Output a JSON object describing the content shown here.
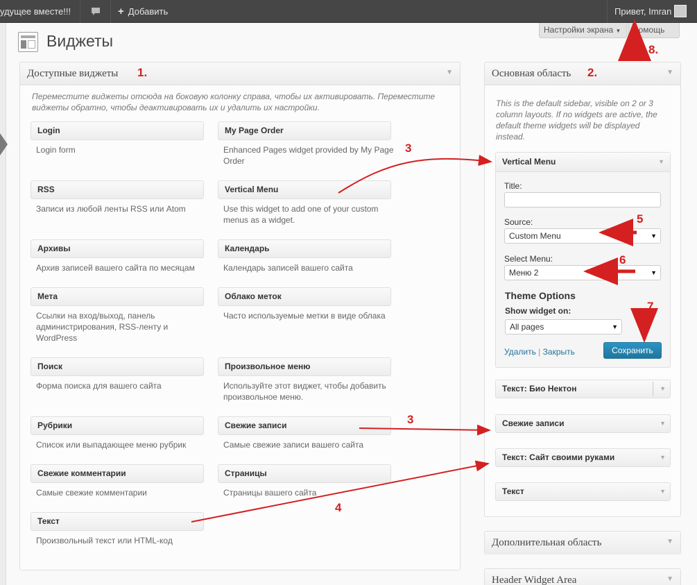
{
  "adminbar": {
    "site": "удущее вместе!!!",
    "comments_icon": "comment-bubble-icon",
    "add_label": "Добавить",
    "account": "Привет, Imran"
  },
  "screen_meta": {
    "screen_options": "Настройки экрана",
    "help": "Помощь"
  },
  "page": {
    "title": "Виджеты"
  },
  "available": {
    "title": "Доступные виджеты",
    "description": "Переместите виджеты отсюда на боковую колонку справа, чтобы их активировать. Переместите виджеты обратно, чтобы деактивировать их и удалить их настройки.",
    "widgets": [
      {
        "title": "Login",
        "desc": "Login form"
      },
      {
        "title": "My Page Order",
        "desc": "Enhanced Pages widget provided by My Page Order"
      },
      {
        "title": "RSS",
        "desc": "Записи из любой ленты RSS или Atom"
      },
      {
        "title": "Vertical Menu",
        "desc": "Use this widget to add one of your custom menus as a widget."
      },
      {
        "title": "Архивы",
        "desc": "Архив записей вашего сайта по месяцам"
      },
      {
        "title": "Календарь",
        "desc": "Календарь записей вашего сайта"
      },
      {
        "title": "Мета",
        "desc": "Ссылки на вход/выход, панель администрирования, RSS-ленту и WordPress"
      },
      {
        "title": "Облако меток",
        "desc": "Часто используемые метки в виде облака"
      },
      {
        "title": "Поиск",
        "desc": "Форма поиска для вашего сайта"
      },
      {
        "title": "Произвольное меню",
        "desc": "Используйте этот виджет, чтобы добавить произвольное меню."
      },
      {
        "title": "Рубрики",
        "desc": "Список или выпадающее меню рубрик"
      },
      {
        "title": "Свежие записи",
        "desc": "Самые свежие записи вашего сайта"
      },
      {
        "title": "Свежие комментарии",
        "desc": "Самые свежие комментарии"
      },
      {
        "title": "Страницы",
        "desc": "Страницы вашего сайта"
      },
      {
        "title": "Текст",
        "desc": "Произвольный текст или HTML-код"
      }
    ]
  },
  "main_area": {
    "title": "Основная область",
    "description": "This is the default sidebar, visible on 2 or 3 column layouts. If no widgets are active, the default theme widgets will be displayed instead.",
    "open_widget": {
      "title": "Vertical Menu",
      "title_label": "Title:",
      "title_value": "",
      "source_label": "Source:",
      "source_value": "Custom Menu",
      "select_menu_label": "Select Menu:",
      "select_menu_value": "Меню 2",
      "theme_options": "Theme Options",
      "show_on_label": "Show widget on:",
      "show_on_value": "All pages",
      "delete_link": "Удалить",
      "link_separator": "|",
      "close_link": "Закрыть",
      "save_button": "Сохранить"
    },
    "active_widgets": [
      {
        "prefix": "Текст:",
        "name": "Био Нектон"
      },
      {
        "prefix": "",
        "name": "Свежие записи"
      },
      {
        "prefix": "Текст:",
        "name": "Сайт своими руками"
      },
      {
        "prefix": "",
        "name": "Текст"
      }
    ]
  },
  "other_areas": [
    "Дополнительная область",
    "Header Widget Area"
  ],
  "annotations": [
    "1.",
    "2.",
    "3",
    "3",
    "4",
    "5",
    "6",
    "7",
    "8."
  ],
  "colors": {
    "annotation_red": "#d42020",
    "save_blue": "#21759b",
    "adminbar": "#464646"
  }
}
